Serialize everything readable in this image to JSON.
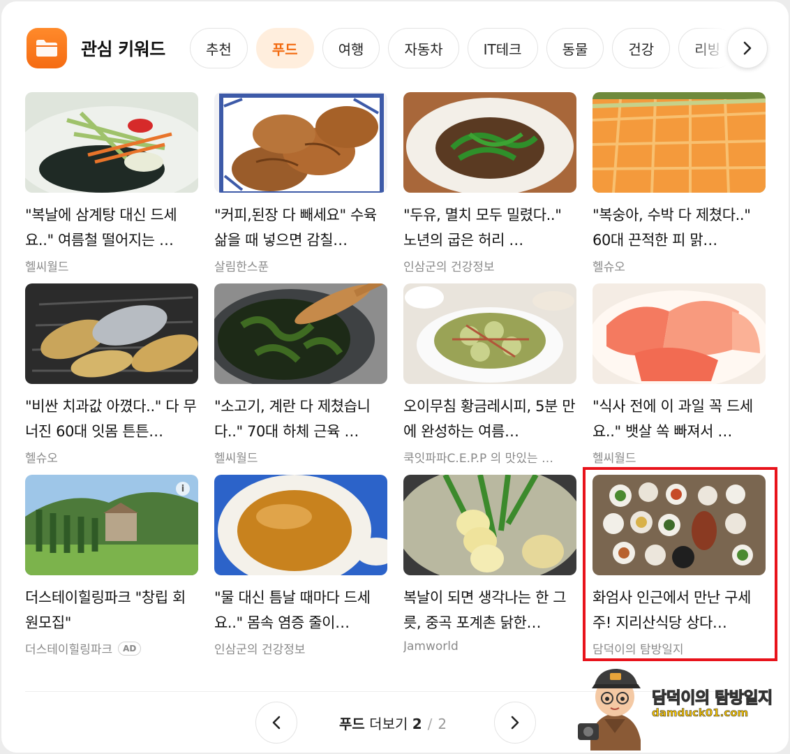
{
  "header": {
    "title": "관심 키워드",
    "icon": "folder-icon"
  },
  "tabs": [
    {
      "label": "추천",
      "active": false
    },
    {
      "label": "푸드",
      "active": true
    },
    {
      "label": "여행",
      "active": false
    },
    {
      "label": "자동차",
      "active": false
    },
    {
      "label": "IT테크",
      "active": false
    },
    {
      "label": "동물",
      "active": false
    },
    {
      "label": "건강",
      "active": false
    },
    {
      "label": "리빙",
      "active": false
    }
  ],
  "cards": [
    {
      "title": "\"복날에 삼계탕 대신 드세요..\" 여름철 떨어지는 …",
      "source": "헬씨월드"
    },
    {
      "title": "\"커피,된장 다 빼세요\" 수육 삶을 때 넣으면 감칠…",
      "source": "살림한스푼"
    },
    {
      "title": "\"두유, 멸치 모두 밀렸다..\" 노년의 굽은 허리 …",
      "source": "인삼군의 건강정보"
    },
    {
      "title": "\"복숭아, 수박 다 제쳤다..\" 60대 끈적한 피 맑…",
      "source": "헬슈오"
    },
    {
      "title": "\"비싼 치과값 아꼈다..\" 다 무너진 60대 잇몸 튼튼…",
      "source": "헬슈오"
    },
    {
      "title": "\"소고기, 계란 다 제쳤습니다..\" 70대 하체 근육 …",
      "source": "헬씨월드"
    },
    {
      "title": "오이무침 황금레시피, 5분 만에 완성하는 여름…",
      "source": "쿡잇파파C.E.P.P 의 맛있는 …"
    },
    {
      "title": "\"식사 전에 이 과일 꼭 드세요..\" 뱃살 쏙 빠져서 …",
      "source": "헬씨월드"
    },
    {
      "title": "더스테이힐링파크 \"창립 회원모집\"",
      "source": "더스테이힐링파크",
      "ad": "AD"
    },
    {
      "title": "\"물 대신 틈날 때마다 드세요..\" 몸속 염증 줄이…",
      "source": "인삼군의 건강정보"
    },
    {
      "title": "복날이 되면 생각나는 한 그릇, 중곡 포계촌 닭한…",
      "source": "Jamworld"
    },
    {
      "title": "화엄사 인근에서 만난 구세주! 지리산식당 상다…",
      "source": "담덕이의 탐방일지"
    }
  ],
  "pager": {
    "category": "푸드",
    "label": "더보기",
    "current": "2",
    "separator": "/",
    "total": "2"
  },
  "watermark": {
    "name": "담덕이의 탐방일지",
    "url": "damduck01.com"
  },
  "colors": {
    "accent": "#f26a0f",
    "highlight": "#e8131b"
  }
}
